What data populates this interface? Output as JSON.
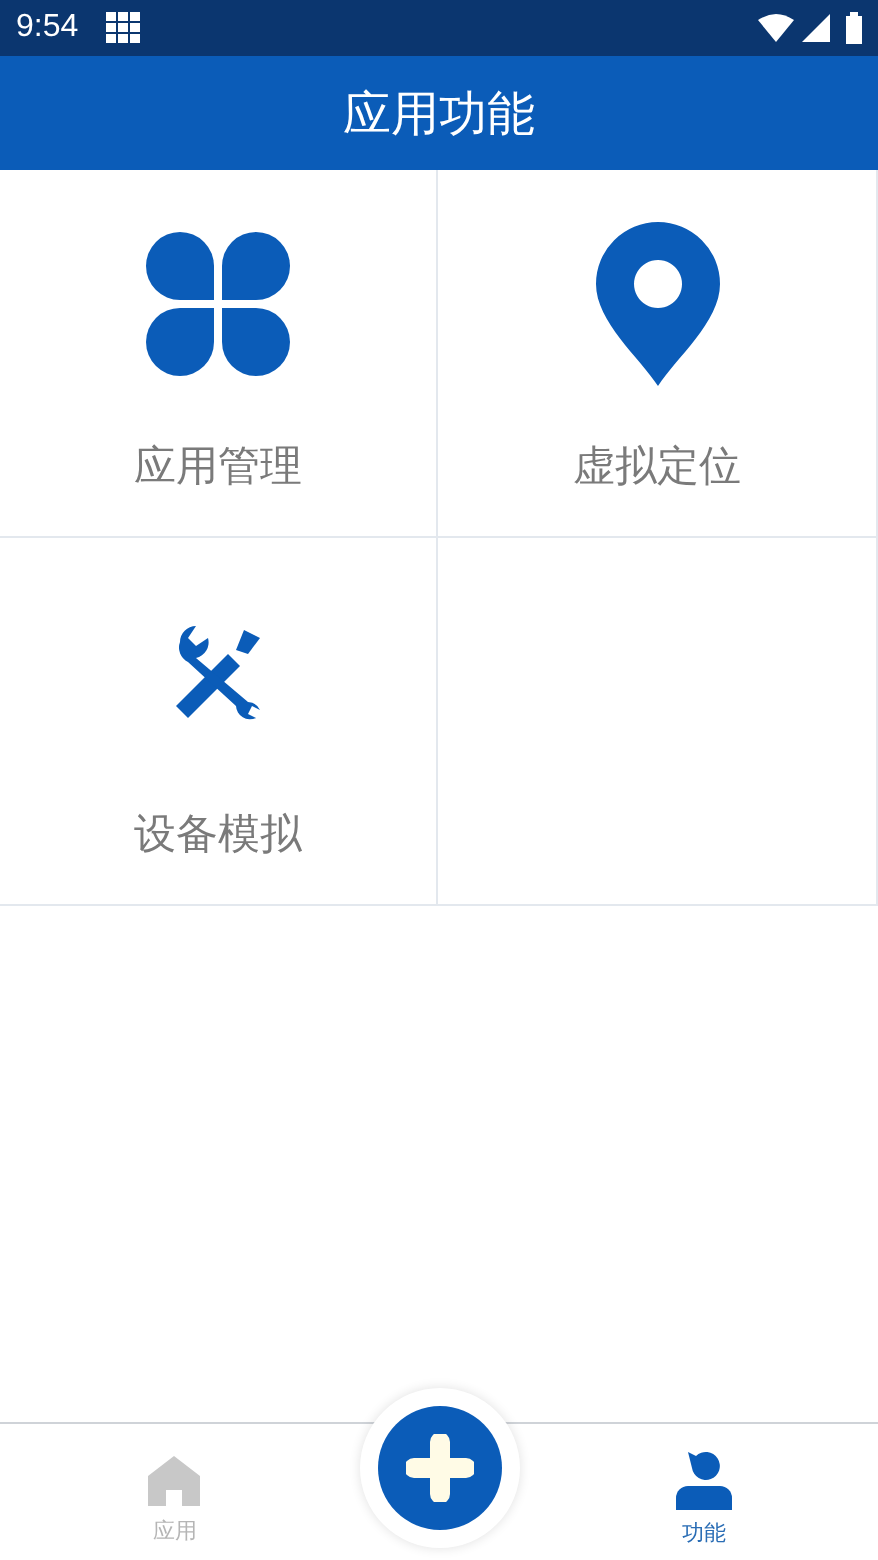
{
  "status_bar": {
    "time": "9:54"
  },
  "header": {
    "title": "应用功能"
  },
  "features": [
    {
      "kind": "clover",
      "label": "应用管理"
    },
    {
      "kind": "pin",
      "label": "虚拟定位"
    },
    {
      "kind": "tools",
      "label": "设备模拟"
    }
  ],
  "bottom_nav": [
    {
      "kind": "home",
      "label": "应用",
      "selected": false
    },
    {
      "kind": "add"
    },
    {
      "kind": "person",
      "label": "功能",
      "selected": true
    }
  ]
}
